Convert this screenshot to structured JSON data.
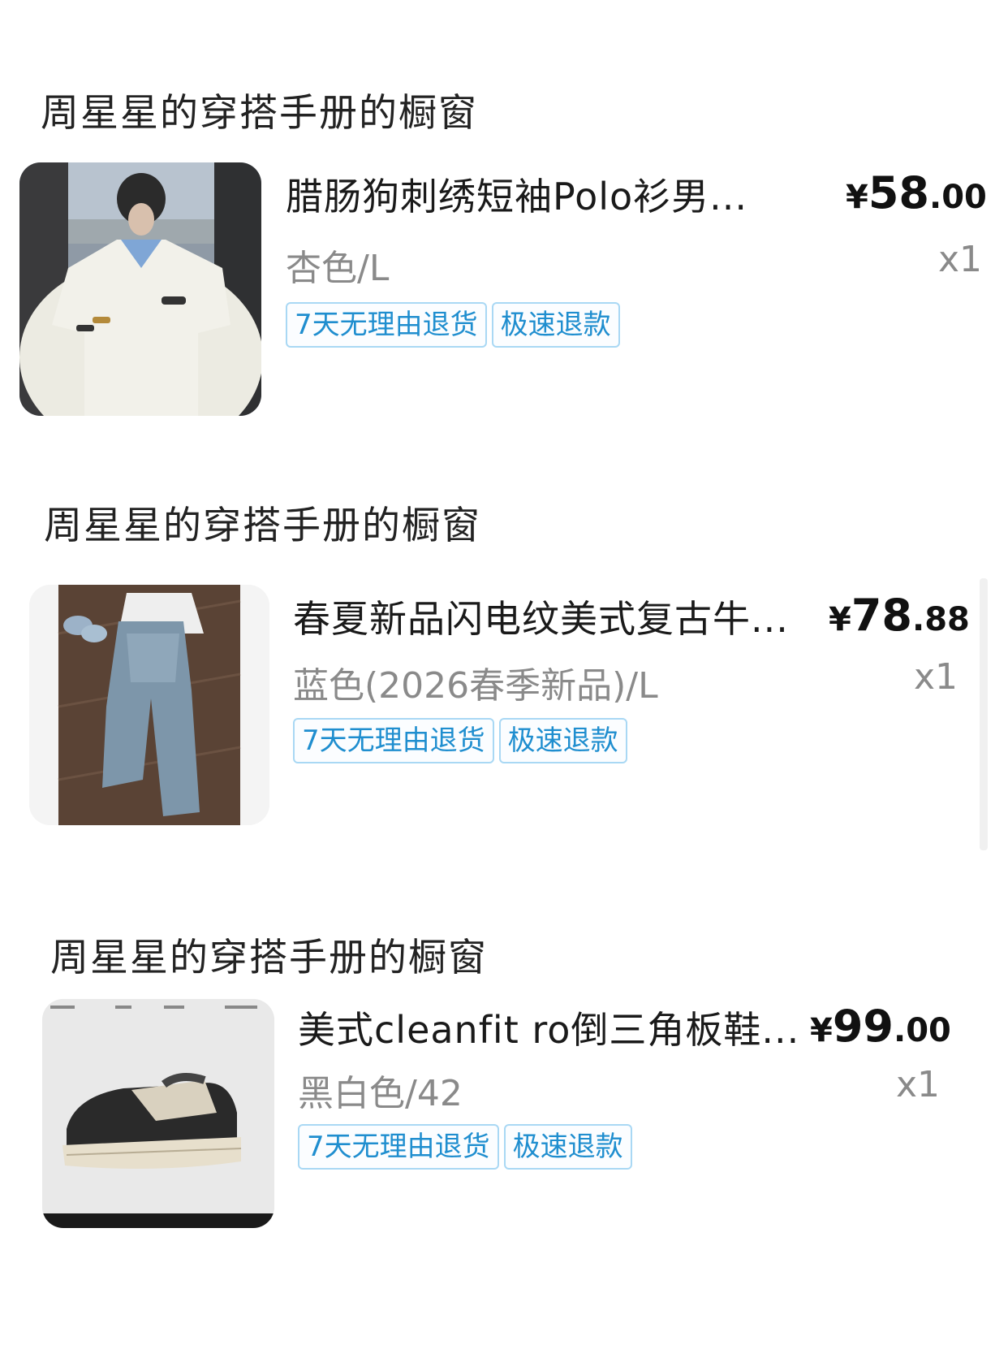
{
  "items": [
    {
      "shop": "周星星的穿搭手册的橱窗",
      "product_name": "腊肠狗刺绣短袖Polo衫男...",
      "price": {
        "currency": "¥",
        "integer": "58",
        "decimal": ".00"
      },
      "sku": "杏色/L",
      "qty": "x1",
      "tags": [
        "7天无理由退货",
        "极速退款"
      ]
    },
    {
      "shop": "周星星的穿搭手册的橱窗",
      "product_name": "春夏新品闪电纹美式复古牛...",
      "price": {
        "currency": "¥",
        "integer": "78",
        "decimal": ".88"
      },
      "sku": "蓝色(2026春季新品)/L",
      "qty": "x1",
      "tags": [
        "7天无理由退货",
        "极速退款"
      ]
    },
    {
      "shop": "周星星的穿搭手册的橱窗",
      "product_name": "美式cleanfit ro倒三角板鞋...",
      "price": {
        "currency": "¥",
        "integer": "99",
        "decimal": ".00"
      },
      "sku": "黑白色/42",
      "qty": "x1",
      "tags": [
        "7天无理由退货",
        "极速退款"
      ]
    }
  ],
  "colors": {
    "tag_text": "#1f8ecf",
    "tag_border": "#a9d8f4",
    "secondary_text": "#8a8a8a"
  }
}
